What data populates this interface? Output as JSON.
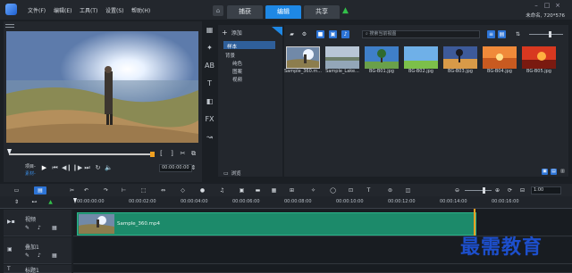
{
  "menu": [
    "文件(F)",
    "编辑(E)",
    "工具(T)",
    "设置(S)",
    "帮助(H)"
  ],
  "modes": [
    "捕获",
    "编辑",
    "共享"
  ],
  "active_mode": "编辑",
  "project_info": "未命名, 720*576",
  "library": {
    "add_label": "添加",
    "tree": [
      "样本",
      "背景",
      "纯色",
      "图案",
      "视频"
    ],
    "browse_label": "浏览",
    "search_placeholder": "搜索当前视图",
    "thumbnails": [
      "Sample_360.m...",
      "Sample_Lake...",
      "BG-B01.jpg",
      "BG-B02.jpg",
      "BG-B03.jpg",
      "BG-B04.jpg",
      "BG-B05.jpg"
    ]
  },
  "player": {
    "project_label": "项目-",
    "clip_label": "素材-",
    "timecode": "00:00:00:00"
  },
  "timeline": {
    "ruler": [
      "00:00:00:00",
      "00:00:02:00",
      "00:00:04:00",
      "00:00:06:00",
      "00:00:08:00",
      "00:00:10:00",
      "00:00:12:00",
      "00:00:14:00",
      "00:00:16:00"
    ],
    "timecode": "1:00",
    "tracks": [
      "视频",
      "叠加1",
      "标题1"
    ],
    "clip_name": "Sample_360.mp4"
  },
  "watermark": "最需教育",
  "colors": {
    "accent": "#1e88e5",
    "clip": "#1c8a6a",
    "playhead": "#f0a020"
  }
}
